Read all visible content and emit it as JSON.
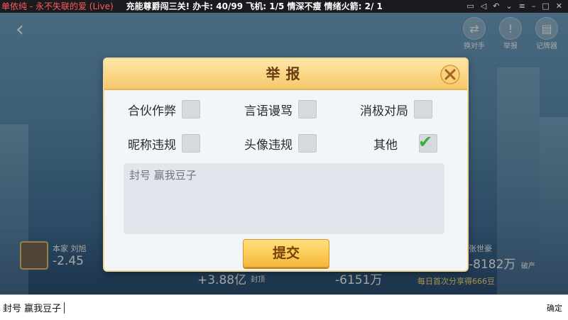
{
  "topbar": {
    "song": "单依纯 - 永不失联的爱 (Live)",
    "marquee": "充能尊爵闯三关! 办卡: 40/99  飞机: 1/5  情深不瘦  情绪火箭: 2/ 1",
    "icons": [
      "screen-icon",
      "volume-icon",
      "undo-icon",
      "chevron-down-icon",
      "menu-icon",
      "minimize-icon",
      "maximize-icon",
      "close-icon"
    ]
  },
  "scene": {
    "top_buttons": [
      "换对手",
      "举报",
      "记牌器"
    ],
    "players": [
      {
        "name": "本家 刘旭",
        "score": "-2.45"
      },
      {
        "name": "张世豪",
        "score": "-8182万",
        "tag": "破产"
      },
      {
        "name": "",
        "score": "+3.88亿",
        "tag": "封顶"
      },
      {
        "name": "",
        "score": "-6151万"
      }
    ],
    "banner": "每日首次分享得666豆"
  },
  "dialog": {
    "title": "举报",
    "options": [
      {
        "label": "合伙作弊",
        "checked": false
      },
      {
        "label": "言语谩骂",
        "checked": false
      },
      {
        "label": "消极对局",
        "checked": false
      },
      {
        "label": "昵称违规",
        "checked": false
      },
      {
        "label": "头像违规",
        "checked": false
      },
      {
        "label": "其他",
        "checked": true
      }
    ],
    "reason_text": "封号  赢我豆子",
    "submit_label": "提交"
  },
  "inputbar": {
    "text": "封号  赢我豆子",
    "confirm_label": "确定"
  },
  "colors": {
    "accent": "#f6c86a",
    "check": "#3dae3a",
    "score_negative": "#ffffff"
  }
}
